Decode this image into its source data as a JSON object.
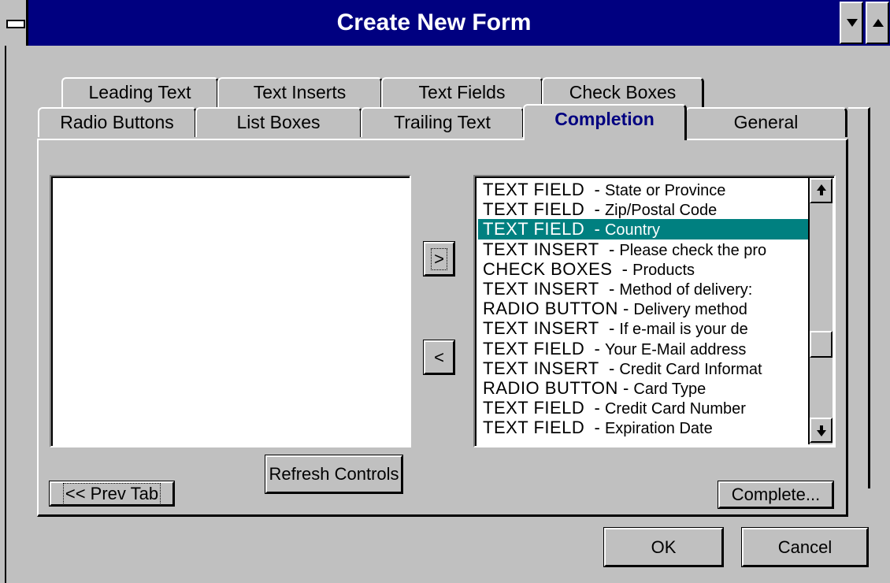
{
  "window": {
    "title": "Create New Form"
  },
  "tabs": {
    "row_back": [
      {
        "label": "Leading Text"
      },
      {
        "label": "Text Inserts"
      },
      {
        "label": "Text Fields"
      },
      {
        "label": "Check Boxes"
      }
    ],
    "row_front": [
      {
        "label": "Radio Buttons"
      },
      {
        "label": "List Boxes"
      },
      {
        "label": "Trailing Text"
      },
      {
        "label": "Completion",
        "selected": true
      },
      {
        "label": "General"
      }
    ]
  },
  "completion": {
    "available_list": [],
    "order_list": [
      {
        "kind": "TEXT FIELD",
        "sep": "  - ",
        "name": "State or Province"
      },
      {
        "kind": "TEXT FIELD",
        "sep": "  - ",
        "name": "Zip/Postal Code"
      },
      {
        "kind": "TEXT FIELD",
        "sep": "  - ",
        "name": "Country",
        "selected": true
      },
      {
        "kind": "TEXT INSERT",
        "sep": "  - ",
        "name": "Please check the pro"
      },
      {
        "kind": "CHECK BOXES",
        "sep": "  - ",
        "name": "Products"
      },
      {
        "kind": "TEXT INSERT",
        "sep": "  - ",
        "name": "Method of delivery:"
      },
      {
        "kind": "RADIO BUTTON",
        "sep": " - ",
        "name": "Delivery method"
      },
      {
        "kind": "TEXT INSERT",
        "sep": "  - ",
        "name": "If e-mail is your de"
      },
      {
        "kind": "TEXT FIELD",
        "sep": "  - ",
        "name": "Your E-Mail address"
      },
      {
        "kind": "TEXT INSERT",
        "sep": "  - ",
        "name": "Credit Card Informat"
      },
      {
        "kind": "RADIO BUTTON",
        "sep": " - ",
        "name": "Card Type"
      },
      {
        "kind": "TEXT FIELD",
        "sep": "  - ",
        "name": "Credit Card Number"
      },
      {
        "kind": "TEXT FIELD",
        "sep": "  - ",
        "name": "Expiration Date"
      }
    ],
    "move_right_label": ">",
    "move_left_label": "<",
    "refresh_label": "Refresh Controls",
    "prev_tab_label": "<< Prev Tab",
    "complete_label": "Complete..."
  },
  "dialog_buttons": {
    "ok_label": "OK",
    "cancel_label": "Cancel"
  },
  "colors": {
    "titlebar": "#000080",
    "face": "#c0c0c0",
    "selection": "#008080",
    "selected_tab_text": "#000080"
  }
}
